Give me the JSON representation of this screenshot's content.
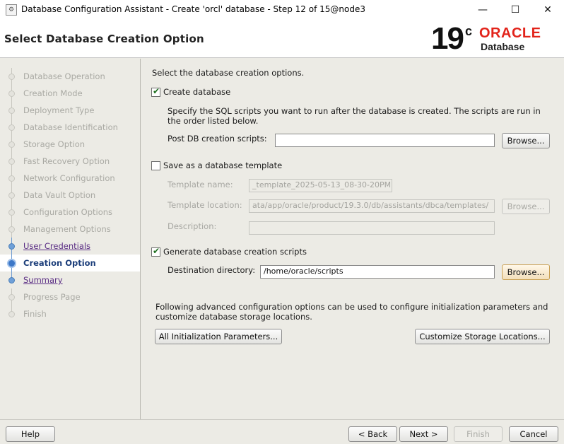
{
  "window": {
    "title": "Database Configuration Assistant - Create 'orcl' database - Step 12 of 15@node3",
    "app_icon": "dbca-app-icon",
    "minimize_glyph": "—",
    "maximize_glyph": "☐",
    "close_glyph": "✕"
  },
  "header": {
    "title": "Select Database Creation Option",
    "logo_version": "19",
    "logo_sup": "c",
    "logo_brand": "ORACLE",
    "logo_product": "Database"
  },
  "sidebar": {
    "steps": [
      {
        "label": "Database Operation",
        "state": "done"
      },
      {
        "label": "Creation Mode",
        "state": "done"
      },
      {
        "label": "Deployment Type",
        "state": "done"
      },
      {
        "label": "Database Identification",
        "state": "done"
      },
      {
        "label": "Storage Option",
        "state": "done"
      },
      {
        "label": "Fast Recovery Option",
        "state": "done"
      },
      {
        "label": "Network Configuration",
        "state": "done"
      },
      {
        "label": "Data Vault Option",
        "state": "done"
      },
      {
        "label": "Configuration Options",
        "state": "done"
      },
      {
        "label": "Management Options",
        "state": "done"
      },
      {
        "label": "User Credentials",
        "state": "link"
      },
      {
        "label": "Creation Option",
        "state": "current"
      },
      {
        "label": "Summary",
        "state": "link"
      },
      {
        "label": "Progress Page",
        "state": "pending"
      },
      {
        "label": "Finish",
        "state": "pending"
      }
    ]
  },
  "main": {
    "intro": "Select the database creation options.",
    "create_db": {
      "label": "Create database",
      "checked": true,
      "desc_line1": "Specify the SQL scripts you want to run after the database is created. The scripts are run in",
      "desc_line2": "the order listed below.",
      "post_scripts_label": "Post DB creation scripts:",
      "post_scripts_value": "",
      "browse_label": "Browse..."
    },
    "save_template": {
      "label": "Save as a database template",
      "checked": false,
      "name_label": "Template name:",
      "name_value": "_template_2025-05-13_08-30-20PM",
      "location_label": "Template location:",
      "location_value": "ata/app/oracle/product/19.3.0/db/assistants/dbca/templates/",
      "browse_label": "Browse...",
      "description_label": "Description:",
      "description_value": ""
    },
    "gen_scripts": {
      "label": "Generate database creation scripts",
      "checked": true,
      "dest_label": "Destination directory:",
      "dest_value": "/home/oracle/scripts",
      "browse_label": "Browse..."
    },
    "advanced_line1": "Following advanced configuration options can be used to configure initialization parameters and",
    "advanced_line2": "customize database storage locations.",
    "init_params_label": "All Initialization Parameters...",
    "storage_label": "Customize Storage Locations..."
  },
  "footer": {
    "help_label": "Help",
    "back_label": "< Back",
    "next_label": "Next >",
    "finish_label": "Finish",
    "cancel_label": "Cancel"
  },
  "check_glyph": "✔"
}
